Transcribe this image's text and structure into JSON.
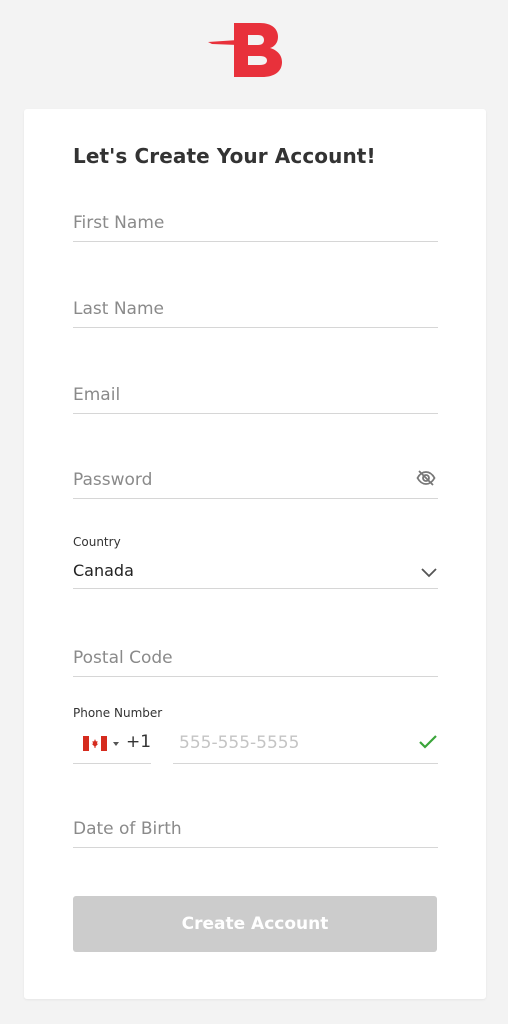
{
  "brand": {
    "logo_letter": "B",
    "accent_color": "#e8313b",
    "logo_icon": "brand-logo-icon"
  },
  "form": {
    "title": "Let's Create Your Account!",
    "first_name": {
      "placeholder": "First Name",
      "value": ""
    },
    "last_name": {
      "placeholder": "Last Name",
      "value": ""
    },
    "email": {
      "placeholder": "Email",
      "value": ""
    },
    "password": {
      "placeholder": "Password",
      "value": "",
      "toggle_icon": "eye-off-icon"
    },
    "country": {
      "label": "Country",
      "selected": "Canada",
      "icon": "chevron-down-icon"
    },
    "postal_code": {
      "placeholder": "Postal Code",
      "value": ""
    },
    "phone": {
      "label": "Phone Number",
      "flag_icon": "canada-flag-icon",
      "dial_code": "+1",
      "placeholder": "555-555-5555",
      "value": "",
      "status_icon": "check-icon",
      "status_color": "#3aa53a"
    },
    "date_of_birth": {
      "placeholder": "Date of Birth",
      "value": ""
    },
    "submit_label": "Create Account",
    "submit_color": "#cccccc"
  }
}
